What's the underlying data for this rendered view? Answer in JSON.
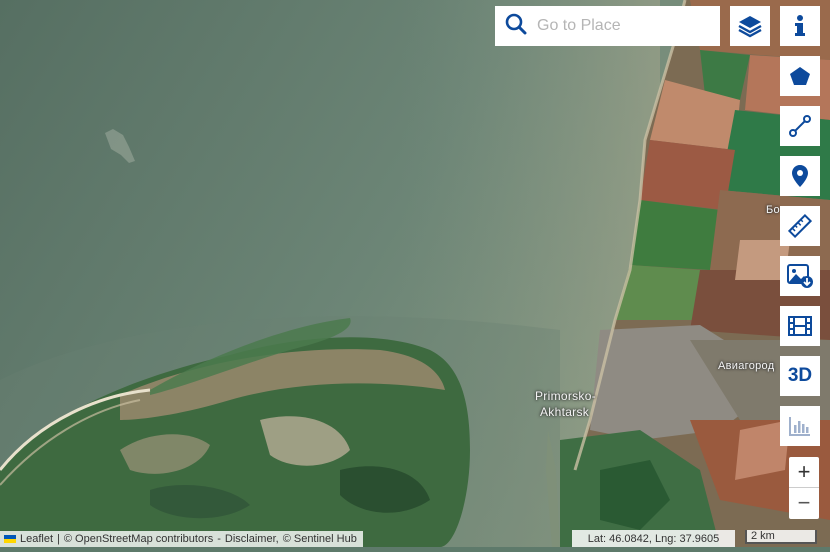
{
  "search": {
    "placeholder": "Go to Place"
  },
  "toolbar": {
    "info": "info-icon",
    "layers": "layers-icon",
    "polygon": "pentagon-icon",
    "line": "line-measure-icon",
    "marker": "map-pin-icon",
    "ruler": "ruler-icon",
    "image_download": "image-download-icon",
    "timelapse": "film-icon",
    "three_d_label": "3D",
    "chart": "bar-chart-icon"
  },
  "zoom": {
    "in_label": "+",
    "out_label": "−"
  },
  "labels": {
    "town_line1": "Primorsko-",
    "town_line2": "Akhtarsk",
    "airfield": "Авиагород",
    "partial": "Бо"
  },
  "attribution": {
    "leaflet": "Leaflet",
    "sep1": "|",
    "osm": "© OpenStreetMap contributors",
    "sep2": "-",
    "disclaimer": "Disclaimer,",
    "sentinel": "© Sentinel Hub"
  },
  "coords": {
    "text": "Lat: 46.0842, Lng: 37.9605"
  },
  "scale": {
    "text": "2 km"
  },
  "colors": {
    "accent": "#0d4a9c",
    "water": "#5f7b6d"
  }
}
